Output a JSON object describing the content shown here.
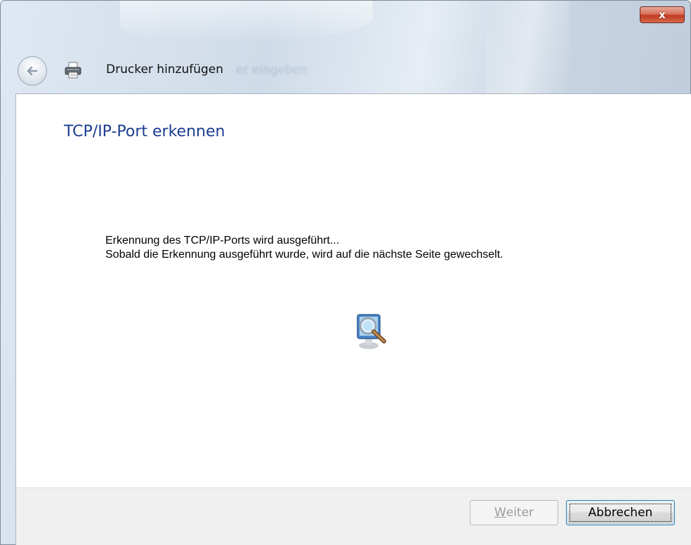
{
  "window": {
    "title": "Drucker hinzufügen",
    "ghost_title": "er eingeben",
    "close_label": "x"
  },
  "page": {
    "heading": "TCP/IP-Port erkennen",
    "status_line1": "Erkennung des TCP/IP-Ports wird ausgeführt...",
    "status_line2": "Sobald die Erkennung ausgeführt wurde, wird auf die nächste Seite gewechselt."
  },
  "buttons": {
    "next_accel": "W",
    "next_rest": "eiter",
    "next_enabled": false,
    "cancel": "Abbrechen"
  },
  "icons": {
    "back": "back-arrow-icon",
    "printer": "printer-icon",
    "search": "search-computer-icon",
    "close": "close-icon"
  },
  "colors": {
    "heading": "#1b3d8f",
    "close_button": "#c0391f"
  }
}
